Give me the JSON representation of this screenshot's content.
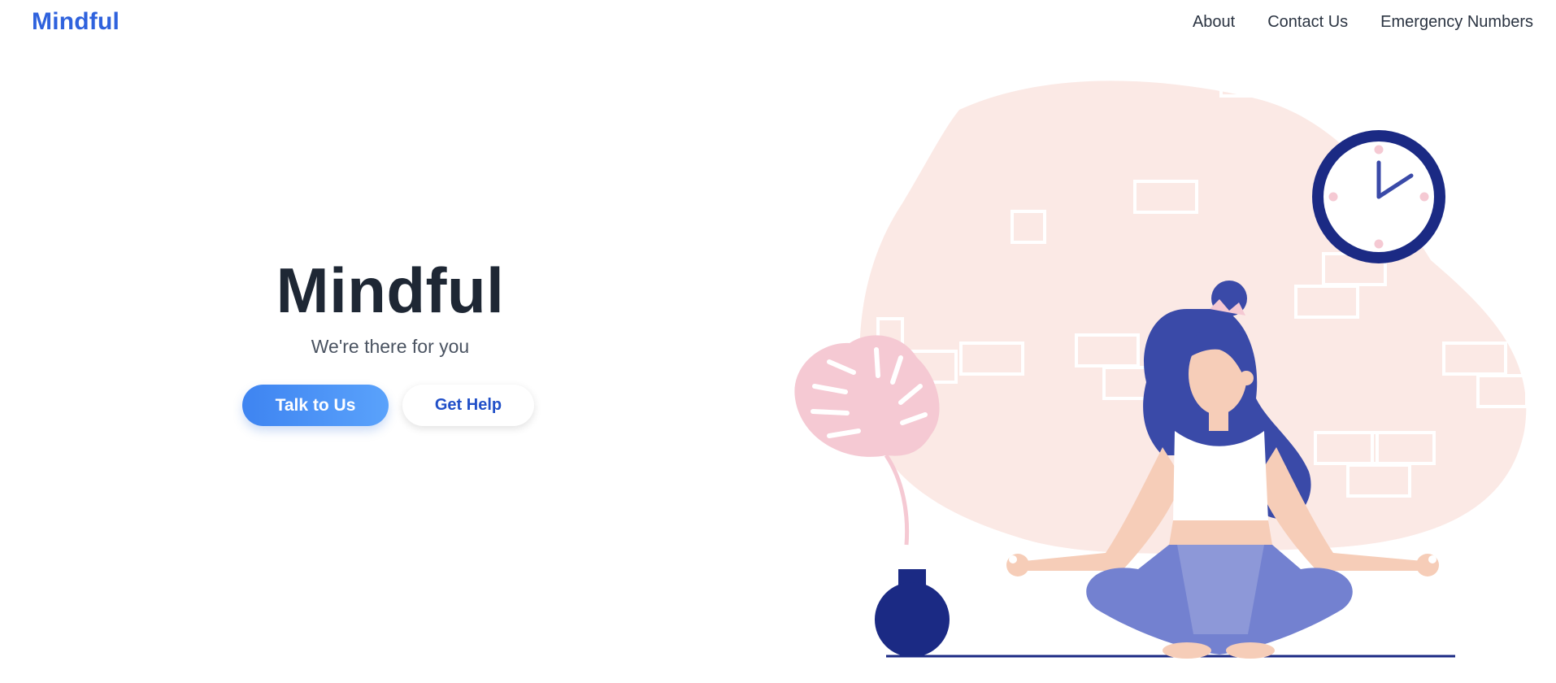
{
  "nav": {
    "brand": "Mindful",
    "links": [
      "About",
      "Contact Us",
      "Emergency Numbers"
    ]
  },
  "hero": {
    "title": "Mindful",
    "subtitle": "We're there for you",
    "primary_button": "Talk to Us",
    "secondary_button": "Get Help"
  },
  "illustration": {
    "subject": "woman-meditating-with-clock-and-plant",
    "colors": {
      "blob": "#fbe9e5",
      "navy": "#1b2a84",
      "hair": "#3a4aa8",
      "skin": "#f6cdb8",
      "pants": "#7381d0",
      "leaf": "#f5c9d3"
    }
  },
  "colors": {
    "brand": "#2f62dd",
    "heading": "#1e2734",
    "body_text": "#4a5361",
    "accent_blue": "#3e84f1"
  }
}
